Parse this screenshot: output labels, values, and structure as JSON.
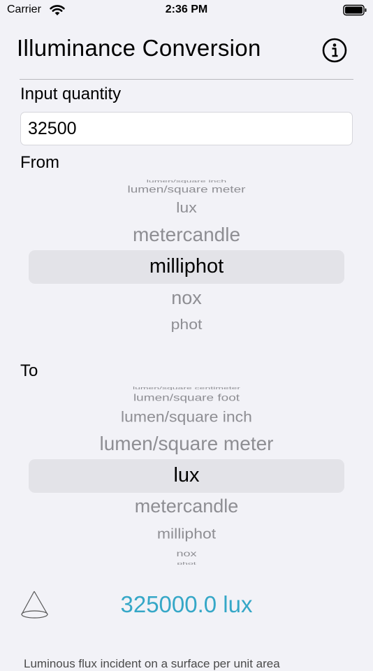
{
  "status_bar": {
    "carrier": "Carrier",
    "time": "2:36 PM"
  },
  "header": {
    "title": "Illuminance Conversion",
    "info_icon": "info-circle-icon"
  },
  "input": {
    "label": "Input quantity",
    "value": "32500"
  },
  "from": {
    "label": "From",
    "items": [
      "lumen/square inch",
      "lumen/square meter",
      "lux",
      "metercandle",
      "milliphot",
      "nox",
      "phot"
    ],
    "selected": "milliphot"
  },
  "to": {
    "label": "To",
    "items": [
      "lumen/square centimeter",
      "lumen/square foot",
      "lumen/square inch",
      "lumen/square meter",
      "lux",
      "metercandle",
      "milliphot",
      "nox",
      "phot"
    ],
    "selected": "lux"
  },
  "result": {
    "icon": "light-cone-icon",
    "text": "325000.0 lux"
  },
  "footer": {
    "text": "Luminous flux incident on a surface per unit area"
  },
  "colors": {
    "background": "#f2f2f7",
    "accent": "#35a7c7",
    "picker_highlight": "#e3e3e8"
  }
}
